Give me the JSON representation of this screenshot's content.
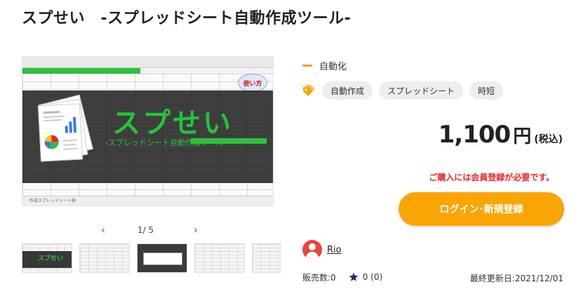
{
  "title": "スプせい　-スプレッドシート自動作成ツール-",
  "gallery": {
    "hero_title": "スプせい",
    "hero_subtitle": "-スプレッドシート自動作成ツール-",
    "usage_bubble": "使い方",
    "sheet_tab": "作成スプレッドシート表",
    "page_current": "1",
    "page_total": "5",
    "page_label": "1/ 5",
    "prev_icon": "chevron-left-icon",
    "next_icon": "chevron-right-icon",
    "thumbnail_count": 5
  },
  "category": "自動化",
  "tags": [
    "自動作成",
    "スプレッドシート",
    "時短"
  ],
  "price": {
    "amount": "1,100",
    "currency": "円",
    "tax": "(税込)"
  },
  "notice": "ご購入には会員登録が必要です。",
  "login_button": "ログイン･新規登録",
  "author": "Rio",
  "stats": {
    "sales": "販売数:0",
    "rating": "0 (0)"
  },
  "updated": "最終更新日:2021/12/01",
  "colors": {
    "accent": "#f9a505",
    "notice": "#e8262a",
    "hero_green": "#25c43a",
    "avatar": "#e4473d",
    "star": "#1f2d6b"
  }
}
